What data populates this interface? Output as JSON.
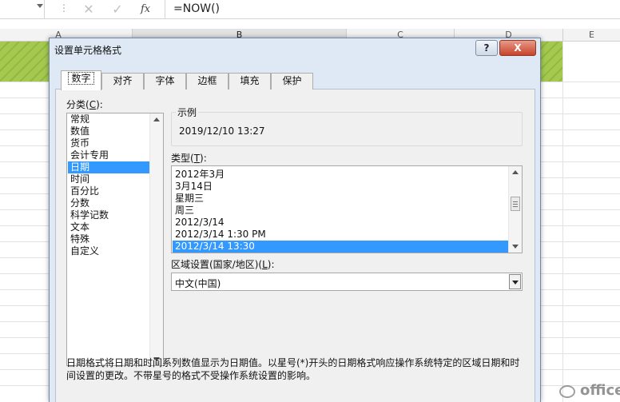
{
  "formula_bar": {
    "cancel_icon": "cancel-x-icon",
    "enter_icon": "check-icon",
    "fx_label": "fx",
    "formula": "=NOW()"
  },
  "columns": [
    "A",
    "B",
    "C",
    "D",
    "E"
  ],
  "dialog": {
    "title": "设置单元格格式",
    "help_label": "?",
    "close_label": "X",
    "tabs": [
      "数字",
      "对齐",
      "字体",
      "边框",
      "填充",
      "保护"
    ],
    "active_tab": "数字",
    "category_label": "分类(C):",
    "categories": [
      "常规",
      "数值",
      "货币",
      "会计专用",
      "日期",
      "时间",
      "百分比",
      "分数",
      "科学记数",
      "文本",
      "特殊",
      "自定义"
    ],
    "selected_category": "日期",
    "sample_label": "示例",
    "sample_value": "2019/12/10 13:27",
    "type_label": "类型(T):",
    "types": [
      "2012年3月",
      "3月14日",
      "星期三",
      "周三",
      "2012/3/14",
      "2012/3/14 1:30 PM",
      "2012/3/14 13:30"
    ],
    "selected_type": "2012/3/14 13:30",
    "region_label": "区域设置(国家/地区)(L):",
    "region_value": "中文(中国)",
    "description_line1": "日期格式将日期和时间系列数值显示为日期值。以星号(*)开头的日期格式响应操作系统特定的区域日期和时",
    "description_line2": "间设置的更改。不带星号的格式不受操作系统设置的影响。"
  },
  "watermark": "office发"
}
